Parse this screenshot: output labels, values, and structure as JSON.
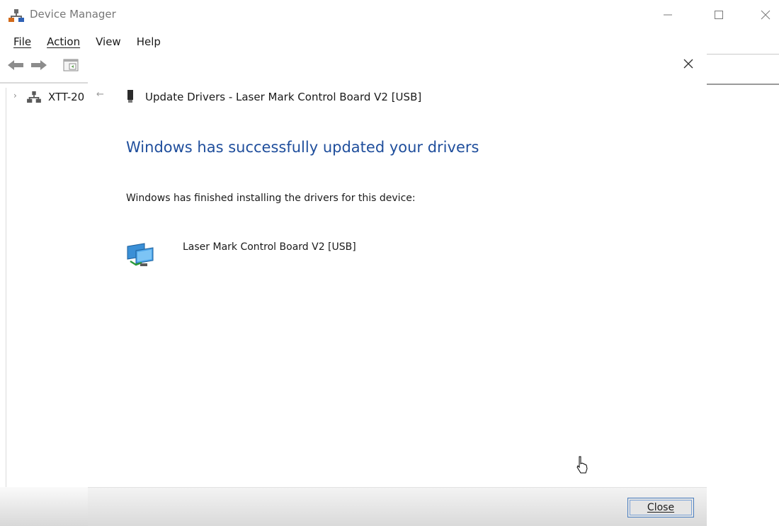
{
  "window": {
    "title": "Device Manager",
    "icons": {
      "app": "device-manager-icon",
      "minimize": "minimize-icon",
      "maximize": "maximize-icon",
      "close": "close-icon"
    }
  },
  "menu": {
    "items": [
      "File",
      "Action",
      "View",
      "Help"
    ]
  },
  "toolbar": {
    "icons": [
      "back-arrow-icon",
      "forward-arrow-icon",
      "properties-icon"
    ]
  },
  "tree": {
    "root_label": "XTT-20",
    "expander_icon": "chevron-right-icon",
    "root_icon": "computer-icon"
  },
  "wizard": {
    "back_glyph": "←",
    "title": "Update Drivers - Laser Mark Control Board V2 [USB]",
    "heading": "Windows has successfully updated your drivers",
    "message": "Windows has finished installing the drivers for this device:",
    "device_name": "Laser Mark Control Board V2 [USB]",
    "device_icon": "network-adapter-icon",
    "close_label": "Close",
    "heading_color": "#1f4e9c"
  }
}
